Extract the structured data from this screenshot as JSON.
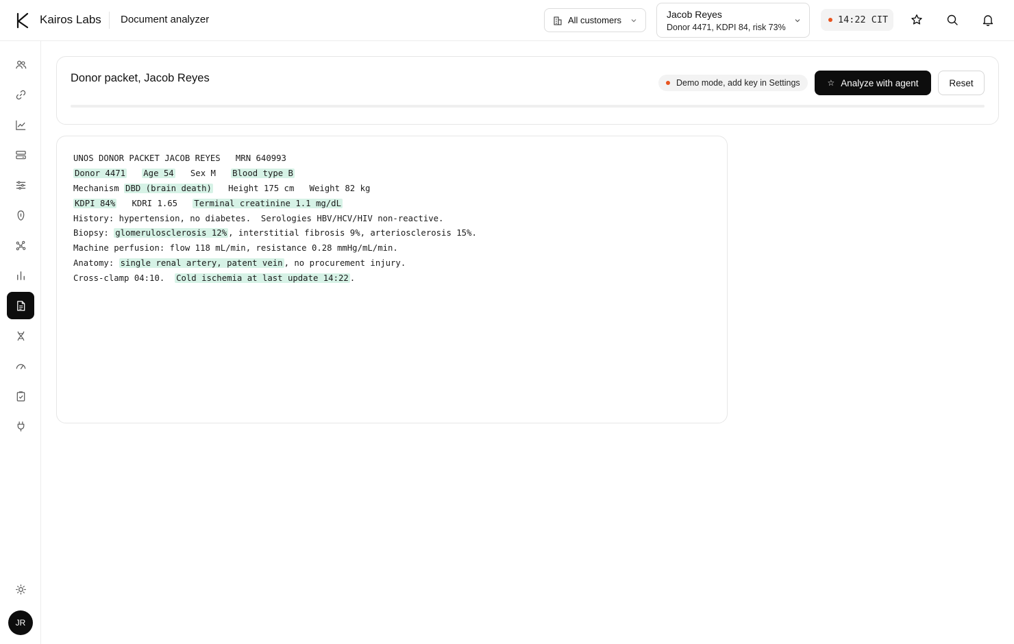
{
  "header": {
    "brand": "Kairos Labs",
    "section_title": "Document analyzer",
    "customer_filter": "All customers",
    "patient": {
      "name": "Jacob Reyes",
      "summary": "Donor 4471, KDPI 84, risk 73%"
    },
    "clock": "14:22 CIT",
    "icons": [
      "star-icon",
      "search-icon",
      "bell-icon"
    ]
  },
  "sidebar": {
    "items": [
      {
        "icon": "users-icon"
      },
      {
        "icon": "link-icon"
      },
      {
        "icon": "trend-chart-icon"
      },
      {
        "icon": "server-icon"
      },
      {
        "icon": "sliders-icon"
      },
      {
        "icon": "kidney-icon"
      },
      {
        "icon": "network-icon"
      },
      {
        "icon": "bar-chart-icon"
      },
      {
        "icon": "document-icon",
        "active": true
      },
      {
        "icon": "dna-icon"
      },
      {
        "icon": "gauge-icon"
      },
      {
        "icon": "clipboard-check-icon"
      },
      {
        "icon": "plug-icon"
      }
    ],
    "theme_icon": "sun-icon",
    "avatar_initials": "JR"
  },
  "packet": {
    "title": "Donor packet, Jacob Reyes",
    "demo_notice": "Demo mode, add key in Settings",
    "analyze_label": "Analyze with agent",
    "reset_label": "Reset",
    "progress": 0
  },
  "document": {
    "lines": [
      [
        {
          "t": "UNOS DONOR PACKET JACOB REYES   MRN 640993"
        }
      ],
      [
        {
          "t": "Donor 4471",
          "h": true
        },
        {
          "t": "   "
        },
        {
          "t": "Age 54",
          "h": true
        },
        {
          "t": "   Sex M   "
        },
        {
          "t": "Blood type B",
          "h": true
        }
      ],
      [
        {
          "t": "Mechanism "
        },
        {
          "t": "DBD (brain death)",
          "h": true
        },
        {
          "t": "   Height 175 cm   Weight 82 kg"
        }
      ],
      [
        {
          "t": "KDPI 84%",
          "h": true
        },
        {
          "t": "   KDRI 1.65   "
        },
        {
          "t": "Terminal creatinine 1.1 mg/dL",
          "h": true
        }
      ],
      [
        {
          "t": "History: hypertension, no diabetes.  Serologies HBV/HCV/HIV non-reactive."
        }
      ],
      [
        {
          "t": "Biopsy: "
        },
        {
          "t": "glomerulosclerosis 12%",
          "h": true
        },
        {
          "t": ", interstitial fibrosis 9%, arteriosclerosis 15%."
        }
      ],
      [
        {
          "t": "Machine perfusion: flow 118 mL/min, resistance 0.28 mmHg/mL/min."
        }
      ],
      [
        {
          "t": "Anatomy: "
        },
        {
          "t": "single renal artery, patent vein",
          "h": true
        },
        {
          "t": ", no procurement injury."
        }
      ],
      [
        {
          "t": "Cross-clamp 04:10.  "
        },
        {
          "t": "Cold ischemia at last update 14:22",
          "h": true
        },
        {
          "t": "."
        }
      ]
    ]
  },
  "colors": {
    "accent": "#0d0d0d",
    "highlight": "#d6f2e6",
    "status_dot": "#e8541f"
  }
}
